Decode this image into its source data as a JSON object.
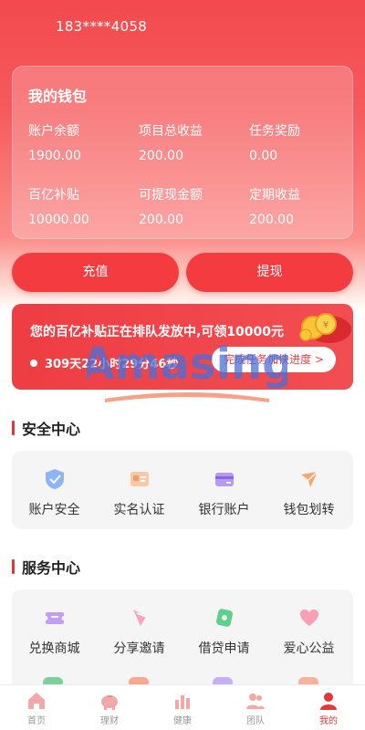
{
  "header": {
    "phone": "183****4058"
  },
  "wallet": {
    "title": "我的钱包",
    "stats": [
      {
        "label": "账户余额",
        "value": "1900.00"
      },
      {
        "label": "项目总收益",
        "value": "200.00"
      },
      {
        "label": "任务奖励",
        "value": "0.00"
      },
      {
        "label": "百亿补贴",
        "value": "10000.00"
      },
      {
        "label": "可提现金额",
        "value": "200.00"
      },
      {
        "label": "定期收益",
        "value": "200.00"
      }
    ]
  },
  "actions": {
    "recharge": "充值",
    "withdraw": "提现"
  },
  "banner": {
    "text": "您的百亿补贴正在排队发放中,可领10000元",
    "countdown": "309天22小时29分46秒",
    "speed_up": "完成任务加快进度 >"
  },
  "watermark": {
    "text": "Amasing"
  },
  "security": {
    "title": "安全中心",
    "items": [
      {
        "label": "账户安全",
        "icon": "shield-icon"
      },
      {
        "label": "实名认证",
        "icon": "id-card-icon"
      },
      {
        "label": "银行账户",
        "icon": "bank-card-icon"
      },
      {
        "label": "钱包划转",
        "icon": "transfer-icon"
      }
    ]
  },
  "services": {
    "title": "服务中心",
    "items": [
      {
        "label": "兑换商城",
        "icon": "ticket-icon"
      },
      {
        "label": "分享邀请",
        "icon": "share-icon"
      },
      {
        "label": "借贷申请",
        "icon": "loan-icon"
      },
      {
        "label": "爱心公益",
        "icon": "heart-icon"
      }
    ]
  },
  "tabs": [
    {
      "label": "首页",
      "icon": "home-icon"
    },
    {
      "label": "理财",
      "icon": "piggy-bank-icon"
    },
    {
      "label": "健康",
      "icon": "health-icon"
    },
    {
      "label": "团队",
      "icon": "team-icon"
    },
    {
      "label": "我的",
      "icon": "user-icon",
      "active": true
    }
  ],
  "colors": {
    "primary": "#f43b3f",
    "accent": "#e5363a"
  }
}
